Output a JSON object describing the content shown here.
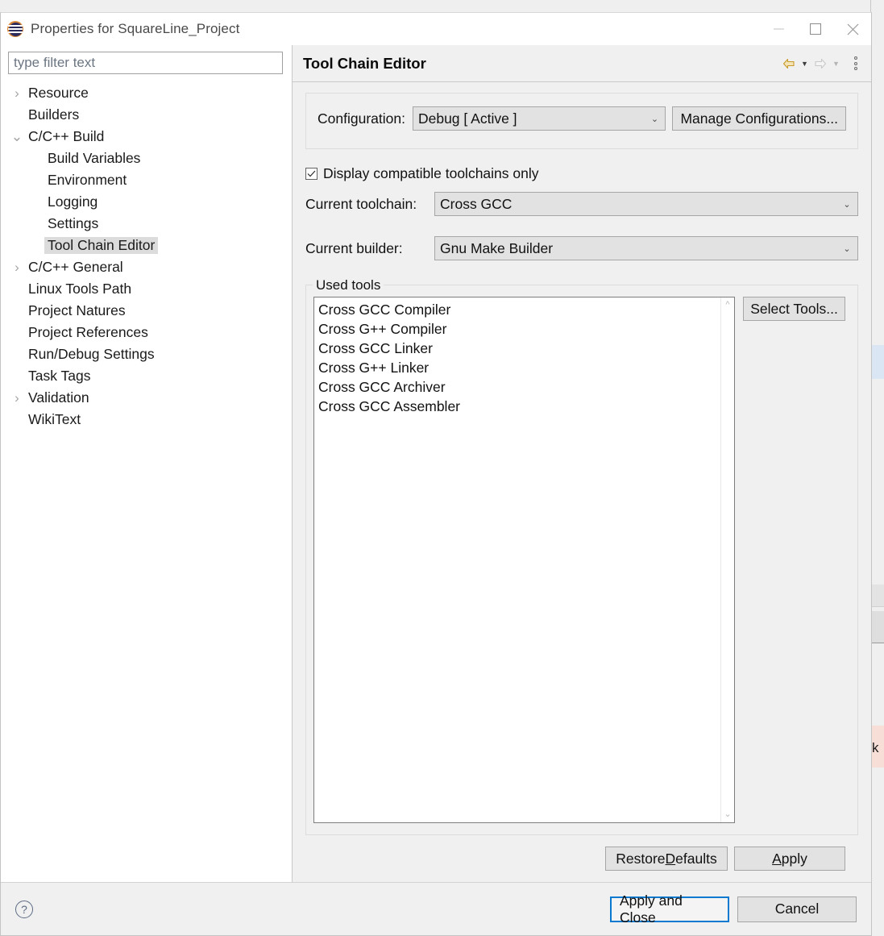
{
  "window": {
    "title": "Properties for SquareLine_Project",
    "icon": "eclipse-logo-icon",
    "controls": {
      "minimize": "minimize-icon",
      "maximize": "maximize-icon",
      "close": "close-icon"
    }
  },
  "sidebar": {
    "filter": {
      "placeholder": "type filter text",
      "value": ""
    },
    "items": [
      {
        "label": "Resource",
        "depth": 1,
        "arrow": "collapsed",
        "selected": false
      },
      {
        "label": "Builders",
        "depth": 1,
        "arrow": "none",
        "selected": false
      },
      {
        "label": "C/C++ Build",
        "depth": 1,
        "arrow": "expanded",
        "selected": false
      },
      {
        "label": "Build Variables",
        "depth": 2,
        "arrow": "none",
        "selected": false
      },
      {
        "label": "Environment",
        "depth": 2,
        "arrow": "none",
        "selected": false
      },
      {
        "label": "Logging",
        "depth": 2,
        "arrow": "none",
        "selected": false
      },
      {
        "label": "Settings",
        "depth": 2,
        "arrow": "none",
        "selected": false
      },
      {
        "label": "Tool Chain Editor",
        "depth": 2,
        "arrow": "none",
        "selected": true
      },
      {
        "label": "C/C++ General",
        "depth": 1,
        "arrow": "collapsed",
        "selected": false
      },
      {
        "label": "Linux Tools Path",
        "depth": 1,
        "arrow": "none",
        "selected": false
      },
      {
        "label": "Project Natures",
        "depth": 1,
        "arrow": "none",
        "selected": false
      },
      {
        "label": "Project References",
        "depth": 1,
        "arrow": "none",
        "selected": false
      },
      {
        "label": "Run/Debug Settings",
        "depth": 1,
        "arrow": "none",
        "selected": false
      },
      {
        "label": "Task Tags",
        "depth": 1,
        "arrow": "none",
        "selected": false
      },
      {
        "label": "Validation",
        "depth": 1,
        "arrow": "collapsed",
        "selected": false
      },
      {
        "label": "WikiText",
        "depth": 1,
        "arrow": "none",
        "selected": false
      }
    ]
  },
  "page": {
    "title": "Tool Chain Editor",
    "nav": {
      "back_icon": "back-arrow-icon",
      "back_caret_icon": "chevron-down-icon",
      "forward_icon": "forward-arrow-icon",
      "forward_caret_icon": "chevron-down-icon",
      "menu_icon": "vertical-dots-icon"
    },
    "configuration": {
      "label": "Configuration:",
      "selected": "Debug  [ Active ]",
      "options": [
        "Debug  [ Active ]"
      ],
      "manage_button": "Manage Configurations..."
    },
    "compatible_only": {
      "label": "Display compatible toolchains only",
      "checked": true
    },
    "toolchain": {
      "label": "Current toolchain:",
      "selected": "Cross GCC",
      "options": [
        "Cross GCC"
      ]
    },
    "builder": {
      "label": "Current builder:",
      "selected": "Gnu Make Builder",
      "options": [
        "Gnu Make Builder"
      ]
    },
    "used_tools": {
      "legend": "Used tools",
      "items": [
        "Cross GCC Compiler",
        "Cross G++ Compiler",
        "Cross GCC Linker",
        "Cross G++ Linker",
        "Cross GCC Archiver",
        "Cross GCC Assembler"
      ],
      "select_button": "Select Tools...",
      "scrollbar": {
        "up_icon": "chevron-up-icon",
        "down_icon": "chevron-down-icon"
      }
    },
    "actions": {
      "restore_defaults": "Restore Defaults",
      "restore_defaults_mnemonic": "D",
      "apply": "Apply",
      "apply_mnemonic": "A"
    }
  },
  "footer": {
    "help_icon": "help-question-icon",
    "apply_and_close": "Apply and Close",
    "cancel": "Cancel"
  },
  "background": {
    "clipped_text": "k"
  },
  "colors": {
    "focus_border": "#0a7ad1",
    "dialog_bg": "#f0f0f0",
    "selection_bg": "#dcdcdc",
    "control_bg": "#e2e2e2",
    "accent_logo": "#2d2a5c"
  }
}
